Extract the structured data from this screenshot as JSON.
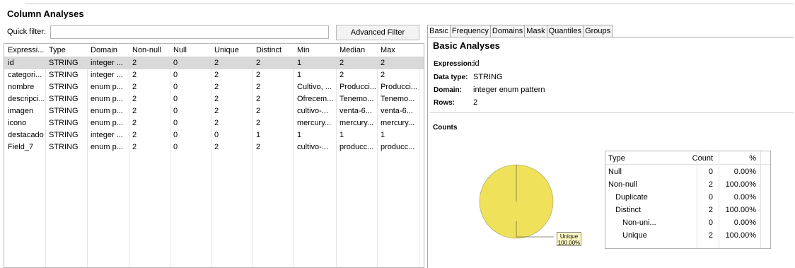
{
  "title": "Column Analyses",
  "quick_filter": {
    "label": "Quick filter:",
    "value": ""
  },
  "advanced_filter_label": "Advanced Filter",
  "columns": [
    "Expressi...",
    "Type",
    "Domain",
    "Non-null",
    "Null",
    "Unique",
    "Distinct",
    "Min",
    "Median",
    "Max"
  ],
  "rows": [
    [
      "id",
      "STRING",
      "integer ...",
      "2",
      "0",
      "2",
      "2",
      "1",
      "2",
      "2"
    ],
    [
      "categori...",
      "STRING",
      "integer ...",
      "2",
      "0",
      "2",
      "2",
      "1",
      "2",
      "2"
    ],
    [
      "nombre",
      "STRING",
      "enum p...",
      "2",
      "0",
      "2",
      "2",
      "Cultivo, ...",
      "Producci...",
      "Producci..."
    ],
    [
      "descripci...",
      "STRING",
      "enum p...",
      "2",
      "0",
      "2",
      "2",
      "Ofrecem...",
      "Tenemo...",
      "Tenemo..."
    ],
    [
      "imagen",
      "STRING",
      "enum p...",
      "2",
      "0",
      "2",
      "2",
      "cultivo-...",
      "venta-6...",
      "venta-6..."
    ],
    [
      "icono",
      "STRING",
      "enum p...",
      "2",
      "0",
      "2",
      "2",
      "mercury...",
      "mercury...",
      "mercury..."
    ],
    [
      "destacado",
      "STRING",
      "integer ...",
      "2",
      "0",
      "0",
      "1",
      "1",
      "1",
      "1"
    ],
    [
      "Field_7",
      "STRING",
      "enum p...",
      "2",
      "0",
      "2",
      "2",
      "cultivo-...",
      "producc...",
      "producc..."
    ]
  ],
  "selected_row": 0,
  "tabs": [
    "Basic",
    "Frequency",
    "Domains",
    "Mask",
    "Quantiles",
    "Groups"
  ],
  "basic": {
    "title": "Basic Analyses",
    "expression_key": "Expression:",
    "expression": "id",
    "data_type_key": "Data type:",
    "data_type": "STRING",
    "domain_key": "Domain:",
    "domain": "integer enum pattern",
    "rows_key": "Rows:",
    "rows": "2"
  },
  "counts": {
    "title": "Counts",
    "pie_label_name": "Unique",
    "pie_label_pct": "100.00%",
    "pie_color": "#f0e15a",
    "headers": [
      "Type",
      "Count",
      "%"
    ],
    "rows": [
      [
        "Null",
        "0",
        "0.00%"
      ],
      [
        "Non-null",
        "2",
        "100.00%"
      ],
      [
        "Duplicate",
        "0",
        "0.00%"
      ],
      [
        "Distinct",
        "2",
        "100.00%"
      ],
      [
        "Non-uni...",
        "0",
        "0.00%"
      ],
      [
        "Unique",
        "2",
        "100.00%"
      ]
    ],
    "indent": [
      0,
      0,
      1,
      1,
      2,
      2
    ]
  }
}
